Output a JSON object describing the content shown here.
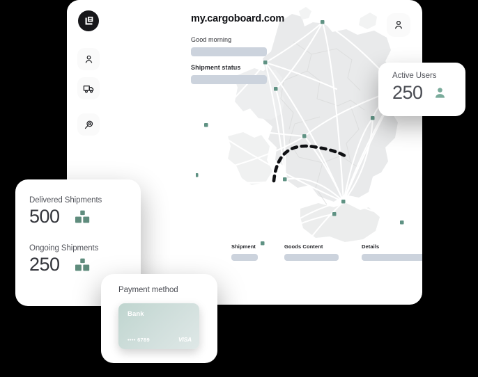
{
  "background_color": "#000000",
  "app": {
    "title": "my.cargoboard.com",
    "logo_icon": "cargoboard-logo-icon",
    "account_icon": "person-icon",
    "sidebar": {
      "items": [
        {
          "icon": "person-icon",
          "name": "profile"
        },
        {
          "icon": "truck-icon",
          "name": "shipments"
        },
        {
          "icon": "search-tracking-icon",
          "name": "tracking"
        }
      ]
    },
    "fields": [
      {
        "label": "Good morning",
        "bold": false,
        "value": ""
      },
      {
        "label": "Shipment status",
        "bold": true,
        "value": ""
      }
    ],
    "table": {
      "columns": [
        {
          "label": "Shipment"
        },
        {
          "label": "Goods Content"
        },
        {
          "label": "Details"
        }
      ]
    },
    "map": {
      "marker_origin_icon": "truck-red-icon",
      "marker_destination_icon": "truck-green-icon",
      "node_color": "#5f9283",
      "land_color": "#e8e9ea",
      "route_color": "#ffffff",
      "dashed_route_color": "#111111"
    }
  },
  "cards": {
    "active_users": {
      "title": "Active Users",
      "value": "250",
      "icon": "person-filled-icon",
      "accent": "#7aab9b"
    },
    "shipments": {
      "stats": [
        {
          "title": "Delivered Shipments",
          "value": "500",
          "icon": "boxes-icon"
        },
        {
          "title": "Ongoing Shipments",
          "value": "250",
          "icon": "boxes-icon"
        }
      ],
      "accent": "#5f8c7d"
    },
    "payment": {
      "title": "Payment method",
      "card": {
        "bank_label": "Bank",
        "number": "•••• 6789",
        "brand": "VISA"
      }
    }
  }
}
